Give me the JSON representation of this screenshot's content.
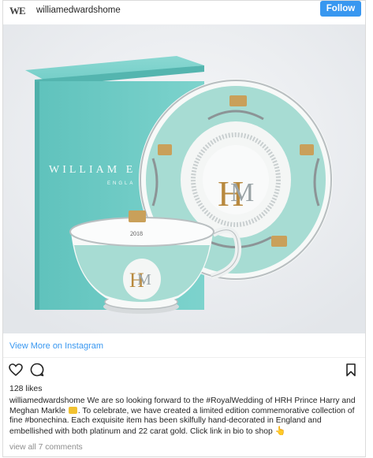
{
  "header": {
    "logo_text": "WE",
    "username": "williamedwardshome",
    "follow_label": "Follow"
  },
  "photo": {
    "box_brand": "WILLIAM E",
    "box_subline": "ENGLA",
    "cup_year": "2018",
    "colors": {
      "box": "#6cc9c3",
      "china_teal": "#9fd8cf",
      "gold": "#c9a05a",
      "background": "#eef0f3"
    }
  },
  "view_more_label": "View More on Instagram",
  "actions": {
    "like_icon": "heart-icon",
    "comment_icon": "comment-icon",
    "save_icon": "bookmark-icon"
  },
  "likes_text": "128 likes",
  "caption": {
    "author": "williamedwardshome",
    "part1": " We are so looking forward to the #RoyalWedding of HRH Prince Harry and Meghan Markle ",
    "part2": ". To celebrate, we have created a limited edition commemorative collection of fine #bonechina. Each exquisite item has been skilfully hand-decorated in England and embellished with both platinum and 22 carat gold. Click link in bio to shop ",
    "hand_glyph": "👆"
  },
  "view_comments_label": "view all 7 comments"
}
